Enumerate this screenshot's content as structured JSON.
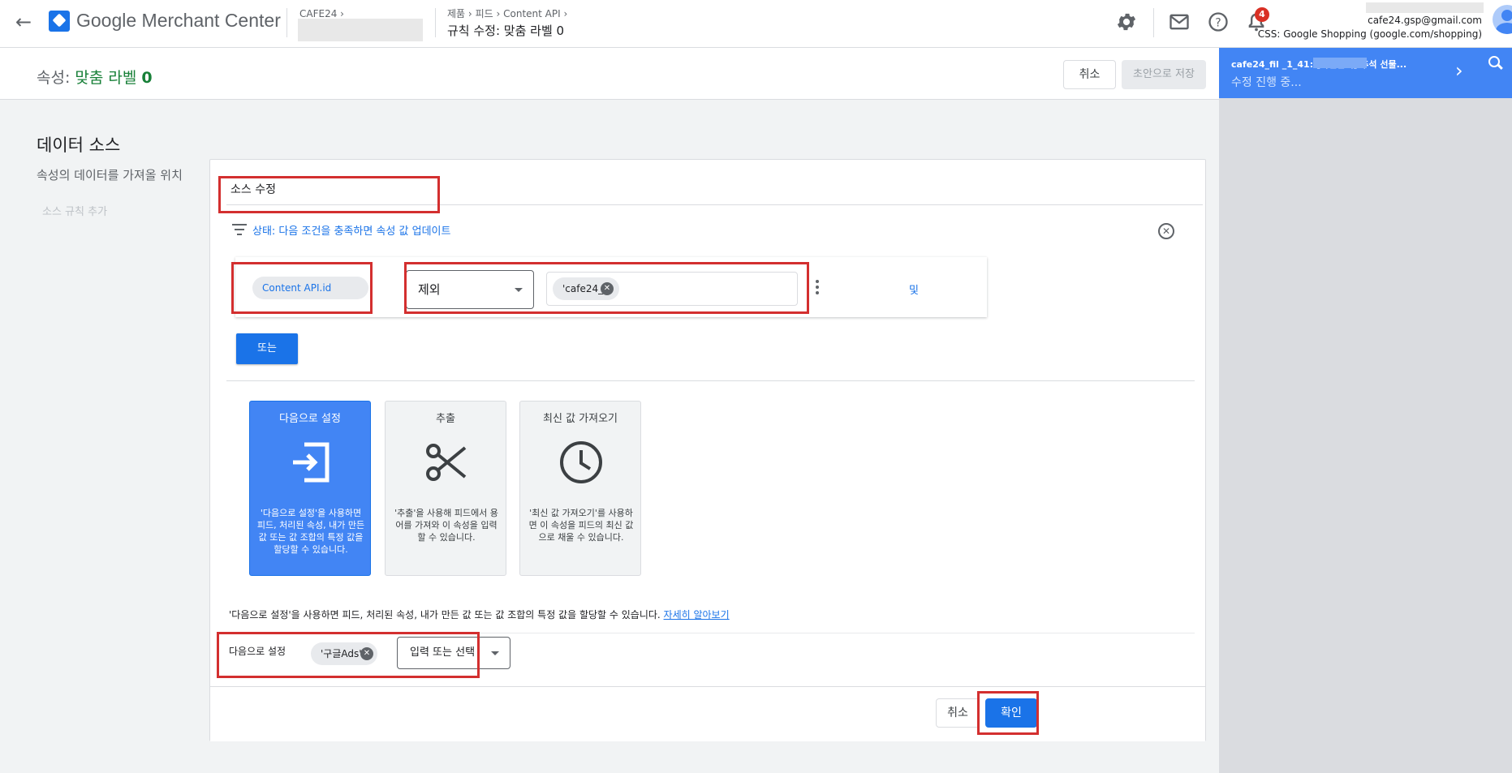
{
  "header": {
    "app_title": "Google Merchant Center",
    "account_name": "CAFE24",
    "breadcrumb": [
      "제품",
      "피드",
      "Content API"
    ],
    "page_title": "규칙 수정: 맞춤 라벨 0",
    "notification_count": "4",
    "user_email": "cafe24.gsp@gmail.com",
    "user_css": "CSS: Google Shopping (google.com/shopping)"
  },
  "subheader": {
    "attr_label": "속성: ",
    "attr_name": "맞춤 라벨 ",
    "attr_index": "0",
    "cancel_label": "취소",
    "save_draft_label": "초안으로 저장"
  },
  "right_panel": {
    "notice_title": "cafe24_fil        _1_41: [사전판매] 추석 선물...",
    "notice_status": "수정 진행 중..."
  },
  "left": {
    "section_title": "데이터 소스",
    "section_sub": "속성의 데이터를 가져올 위치",
    "add_rule_link": "소스 규칙 추가"
  },
  "card": {
    "title": "소스 수정",
    "condition_text": "상태: 다음 조건을 충족하면 속성 값 업데이트",
    "rule": {
      "attribute": "Content API.id",
      "operator": "제외",
      "value_chip": "'cafe24_'",
      "and_label": "및"
    },
    "or_label": "또는",
    "tiles": [
      {
        "title": "다음으로 설정",
        "desc": "'다음으로 설정'을 사용하면 피드, 처리된 속성, 내가 만든 값 또는 값 조합의 특정 값을 할당할 수 있습니다."
      },
      {
        "title": "추출",
        "desc": "'추출'을 사용해 피드에서 용어를 가져와 이 속성을 입력할 수 있습니다."
      },
      {
        "title": "최신 값 가져오기",
        "desc": "'최신 값 가져오기'를 사용하면 이 속성을 피드의 최신 값으로 채울 수 있습니다."
      }
    ],
    "help_text": "'다음으로 설정'을 사용하면 피드, 처리된 속성, 내가 만든 값 또는 값 조합의 특정 값을 할당할 수 있습니다. ",
    "help_link": "자세히 알아보기",
    "set_to_label": "다음으로 설정",
    "set_to_chip": "'구글Ads'",
    "input_placeholder": "입력 또는 선택",
    "footer_cancel": "취소",
    "footer_confirm": "확인"
  },
  "colors": {
    "accent": "#1a73e8",
    "highlight_box": "#d32f2f",
    "selected_tile": "#4285f4",
    "badge": "#d93025"
  },
  "icons": [
    "back-arrow-icon",
    "merchant-logo-icon",
    "gear-icon",
    "mail-icon",
    "help-icon",
    "bell-icon",
    "avatar",
    "chevron-right-icon",
    "search-icon",
    "filter-icon",
    "close-circle-icon",
    "chevron-down-icon",
    "kebab-icon",
    "set-to-icon",
    "scissors-icon",
    "clock-icon"
  ]
}
